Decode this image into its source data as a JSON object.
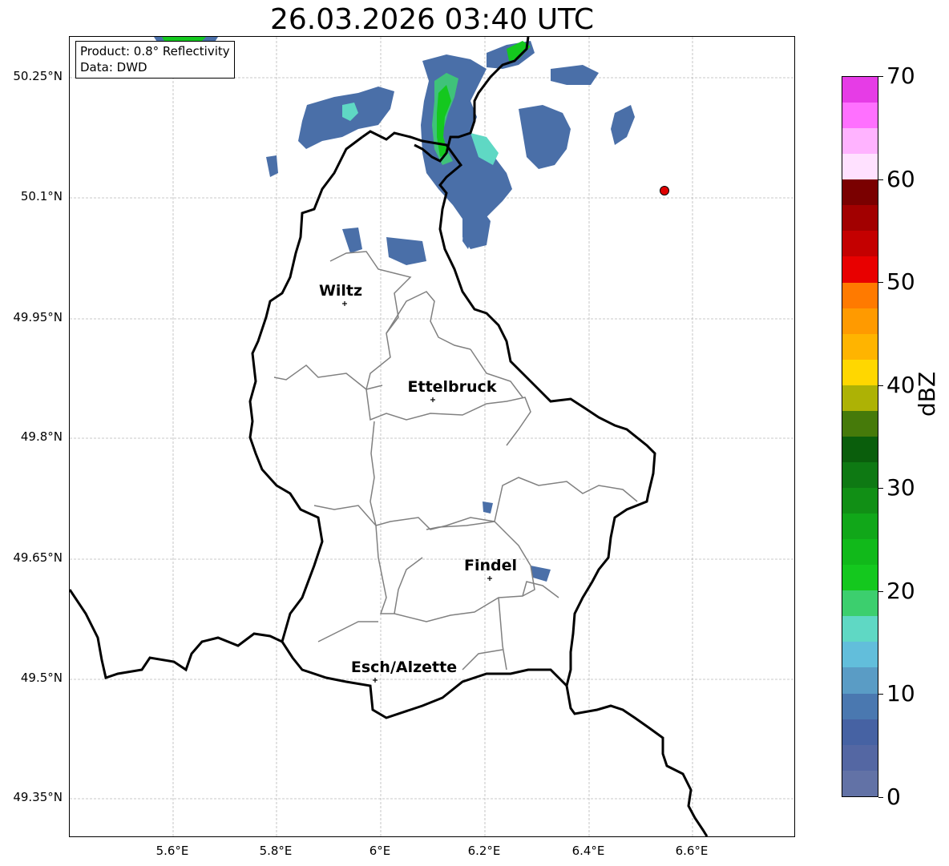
{
  "title": "26.03.2026 03:40 UTC",
  "info_box": {
    "line1": "Product: 0.8° Reflectivity",
    "line2": "Data: DWD"
  },
  "y_tick_labels": [
    "50.25°N",
    "50.1°N",
    "49.95°N",
    "49.8°N",
    "49.65°N",
    "49.5°N",
    "49.35°N"
  ],
  "x_tick_labels": [
    "5.6°E",
    "5.8°E",
    "6°E",
    "6.2°E",
    "6.4°E",
    "6.6°E"
  ],
  "cities": [
    {
      "name": "Wiltz",
      "lon": 5.93,
      "lat": 49.97
    },
    {
      "name": "Ettelbruck",
      "lon": 6.1,
      "lat": 49.85
    },
    {
      "name": "Findel",
      "lon": 6.21,
      "lat": 49.627
    },
    {
      "name": "Esch/Alzette",
      "lon": 5.99,
      "lat": 49.5
    }
  ],
  "marker": {
    "lon": 6.55,
    "lat": 50.11,
    "color": "#e00000"
  },
  "colorbar": {
    "label": "dBZ",
    "min": 0,
    "max": 70,
    "tick_labels": [
      "0",
      "10",
      "20",
      "30",
      "40",
      "50",
      "60",
      "70"
    ],
    "colors": [
      "#6272a6",
      "#5467a3",
      "#4662a3",
      "#4a78b0",
      "#5a9cc5",
      "#62bedb",
      "#5fd8c4",
      "#3ccf6e",
      "#14c81e",
      "#11b91a",
      "#11a719",
      "#118f15",
      "#0e7913",
      "#0a5e0c",
      "#467a0a",
      "#adb205",
      "#ffd700",
      "#ffb400",
      "#ff9a00",
      "#ff7a00",
      "#e80000",
      "#c40000",
      "#a20000",
      "#7a0000",
      "#ffe1ff",
      "#ffb3ff",
      "#ff70ff",
      "#e63ce6"
    ]
  },
  "colors": {
    "country_border": "#000000",
    "canton_border": "#808080",
    "grid": "#b0b0b0"
  }
}
